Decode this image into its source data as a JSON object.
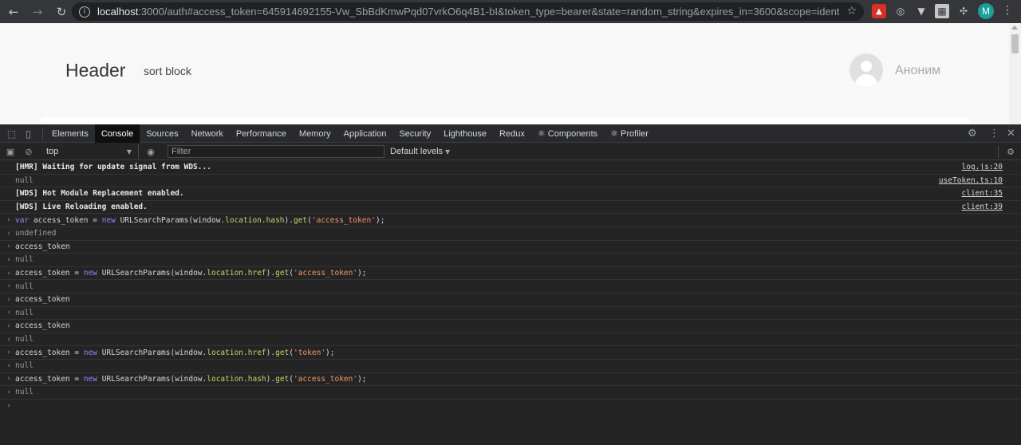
{
  "browser": {
    "url_host": "localhost",
    "url_rest": ":3000/auth#access_token=645914692155-Vw_SbBdKmwPqd07vrkO6q4B1-bI&token_type=bearer&state=random_string&expires_in=3600&scope=identity+read+submit",
    "profile_initial": "M"
  },
  "page": {
    "header_title": "Header",
    "sort_block": "sort block",
    "user_name": "Аноним"
  },
  "devtools": {
    "tabs": [
      "Elements",
      "Console",
      "Sources",
      "Network",
      "Performance",
      "Memory",
      "Application",
      "Security",
      "Lighthouse",
      "Redux",
      "⚛ Components",
      "⚛ Profiler"
    ],
    "active_tab": "Console",
    "context": "top",
    "filter_placeholder": "Filter",
    "levels": "Default levels"
  },
  "console": {
    "logs": [
      {
        "text": "[HMR] Waiting for update signal from WDS...",
        "source": "log.js:20"
      },
      {
        "text": "null",
        "source": "useToken.ts:10"
      },
      {
        "text": "[WDS] Hot Module Replacement enabled.",
        "source": "client:35"
      },
      {
        "text": "[WDS] Live Reloading enabled.",
        "source": "client:39"
      }
    ],
    "entries": [
      {
        "input": "var access_token = new URLSearchParams(window.location.hash).get('access_token');",
        "output": "undefined"
      },
      {
        "input": "access_token",
        "output": "null"
      },
      {
        "input": "access_token = new URLSearchParams(window.location.href).get('access_token');",
        "output": "null"
      },
      {
        "input": "access_token",
        "output": "null"
      },
      {
        "input": "access_token",
        "output": "null"
      },
      {
        "input": "access_token = new URLSearchParams(window.location.href).get('token');",
        "output": "null"
      },
      {
        "input": "access_token = new URLSearchParams(window.location.hash).get('access_token');",
        "output": "null"
      }
    ]
  }
}
